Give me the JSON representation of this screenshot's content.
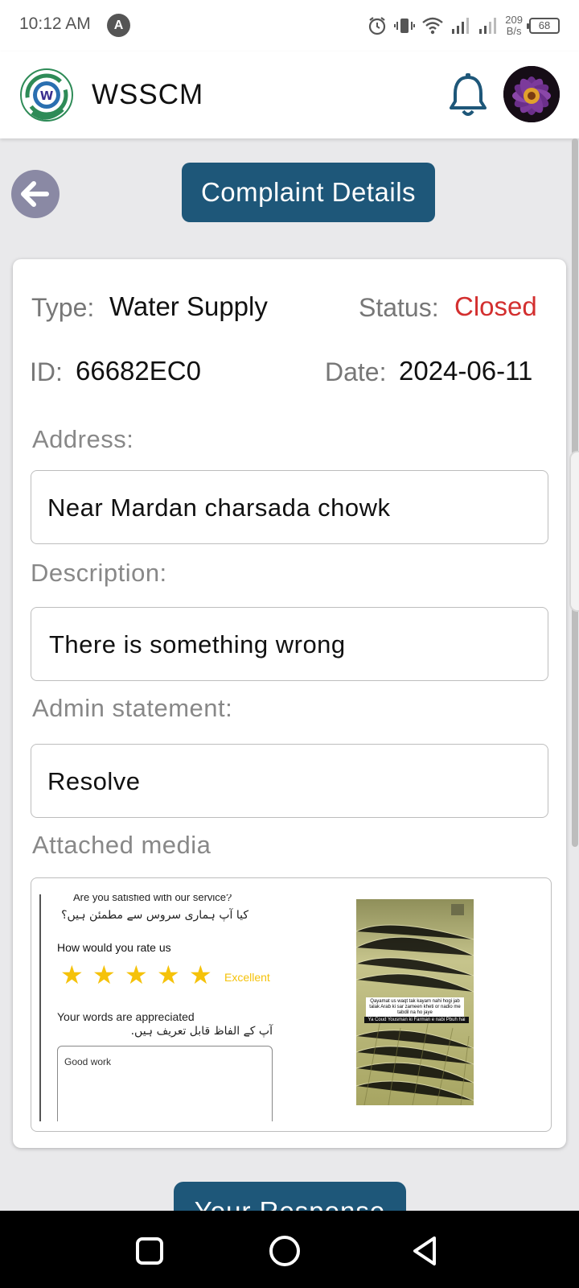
{
  "status_bar": {
    "time": "10:12 AM",
    "a_badge": "A",
    "net_speed_value": "209",
    "net_speed_unit": "B/s",
    "battery": "68"
  },
  "header": {
    "app_name": "WSSCM",
    "logo_letter": "W",
    "notification_icon": "bell-icon",
    "avatar_icon": "avatar-flower"
  },
  "page": {
    "title": "Complaint Details",
    "back_icon": "back-arrow-icon"
  },
  "complaint": {
    "type_label": "Type:",
    "type_value": "Water Supply",
    "status_label": "Status:",
    "status_value": "Closed",
    "status_color": "#d32f2f",
    "id_label": "ID:",
    "id_value": "66682EC0",
    "date_label": "Date:",
    "date_value": "2024-06-11",
    "address_label": "Address:",
    "address_value": "Near Mardan charsada chowk",
    "description_label": "Description:",
    "description_value": "There is something wrong",
    "admin_label": "Admin statement:",
    "admin_value": "Resolve",
    "media_label": "Attached media"
  },
  "media": {
    "form": {
      "question": "Are you satisfied with our service?",
      "question_urdu": "کیا آپ ہماری سروس سے مطمئن ہیں؟",
      "rate_label": "How would you rate us",
      "rating": 5,
      "rating_text": "Excellent",
      "words_label": "Your words are appreciated",
      "words_urdu": "آپ کے الفاظ قابل تعریف ہیں.",
      "comment": "Good work"
    },
    "video": {
      "caption": "Qayamat us waqt tak kayam nahi hogi jab talak Arab ki sar zameen kheti or nadio me tabdil na ho jaye",
      "caption2": "Ya Coud Yousman ki Farman e nabi Pbuh hai"
    }
  },
  "bottom_button": {
    "label": "Your Response"
  },
  "colors": {
    "primary": "#1e5779",
    "back_button": "#8a89a4",
    "star": "#f5c20a"
  }
}
